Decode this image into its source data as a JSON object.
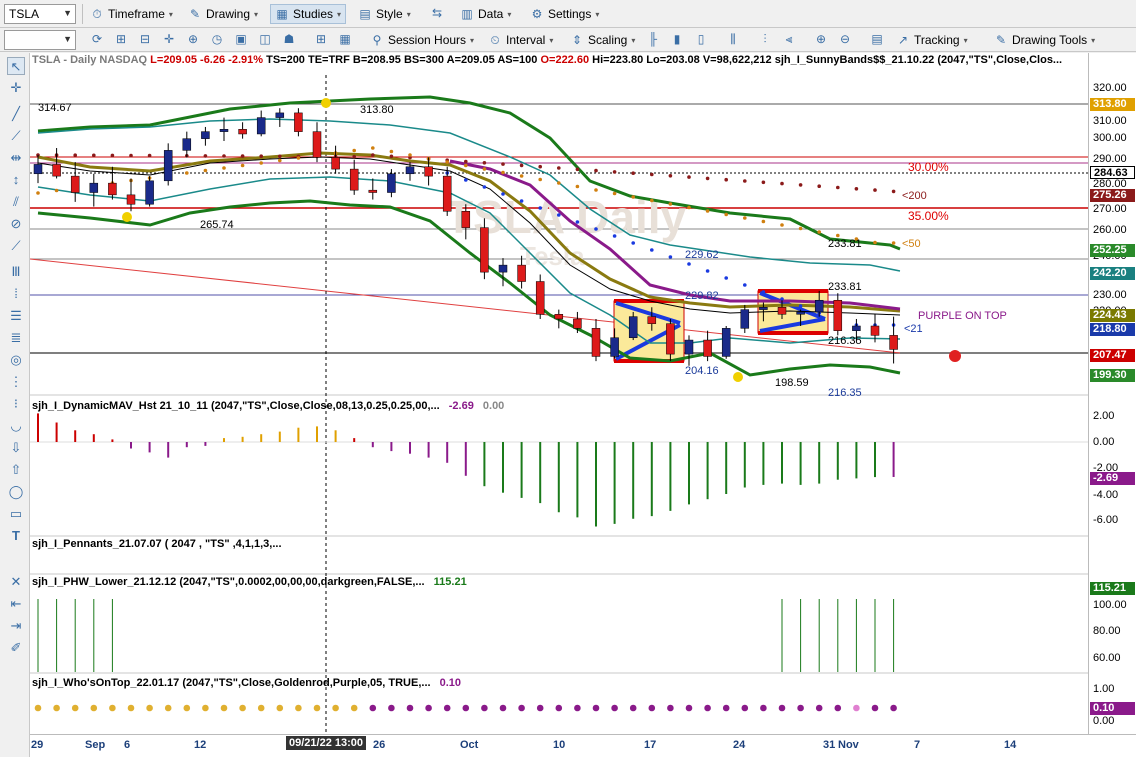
{
  "toolbar1": {
    "symbol": "TSLA",
    "timeframe": "Timeframe",
    "drawing": "Drawing",
    "studies": "Studies",
    "style": "Style",
    "data": "Data",
    "settings": "Settings"
  },
  "toolbar2": {
    "session_hours": "Session Hours",
    "interval": "Interval",
    "scaling": "Scaling",
    "tracking": "Tracking",
    "drawing_tools": "Drawing Tools"
  },
  "header": {
    "symbol_info": "TSLA - Daily  NASDAQ",
    "last": "L=209.05",
    "change": "-6.26",
    "pct": "-2.91%",
    "rest": "TS=200  TE=TRF  B=208.95  BS=300  A=209.05  AS=100",
    "open": "O=222.60",
    "hilo": "Hi=223.80  Lo=203.08  V=98,622,212  sjh_I_SunnyBands$$_21.10.22 (2047,\"TS\",Close,Clos..."
  },
  "annotations": {
    "a1": "314.67",
    "a2": "313.80",
    "a3": "265.74",
    "a4": "229.62",
    "a5": "229.82",
    "a6": "233.81",
    "a7": "233.81",
    "a8": "216.35",
    "a9": "204.16",
    "a10": "198.59",
    "a11": "216.35",
    "pct30": "30.00%",
    "pct35": "35.00%",
    "lt200": "<200",
    "lt50": "<50",
    "lt21": "<21",
    "purple": "PURPLE ON TOP",
    "watermark": "TSLA Daily",
    "watermark2": "Tesla"
  },
  "price_axis": [
    "320.00",
    "310.00",
    "300.00",
    "290.00",
    "280.00",
    "270.00",
    "260.00",
    "240.00",
    "230.00",
    "220.00"
  ],
  "price_tags": [
    {
      "label": "313.80",
      "color": "#e0a000"
    },
    {
      "label": "284.63",
      "color": "#ffffff",
      "fg": "#000"
    },
    {
      "label": "275.26",
      "color": "#8b1a1a"
    },
    {
      "label": "252.25",
      "color": "#2a8a2a"
    },
    {
      "label": "242.20",
      "color": "#1a8080"
    },
    {
      "label": "224.43",
      "color": "#7a7a00"
    },
    {
      "label": "218.80",
      "color": "#1a3aaa"
    },
    {
      "label": "207.47",
      "color": "#cc0000"
    },
    {
      "label": "199.30",
      "color": "#2a8a2a"
    }
  ],
  "panes": {
    "dynmav": {
      "title": "sjh_I_DynamicMAV_Hst 21_10_11 (2047,\"TS\",Close,Close,08,13,0.25,0.25,00,...",
      "v1": "-2.69",
      "v2": "0.00",
      "axis": [
        "2.00",
        "0.00",
        "-2.00",
        "-4.00",
        "-6.00"
      ],
      "tag": "-2.69"
    },
    "pennants": {
      "title": "sjh_I_Pennants_21.07.07 ( 2047 , \"TS\" ,4,1,1,3,..."
    },
    "phw": {
      "title": "sjh_I_PHW_Lower_21.12.12 (2047,\"TS\",0.0002,00,00,00,darkgreen,FALSE,...",
      "v1": "115.21",
      "axis": [
        "100.00",
        "80.00",
        "60.00"
      ],
      "tag": "115.21"
    },
    "whos": {
      "title": "sjh_I_Who'sOnTop_22.01.17 (2047,\"TS\",Close,Goldenrod,Purple,05, TRUE,...",
      "v1": "0.10",
      "axis": [
        "1.00",
        "0.00"
      ],
      "tag": "0.10"
    }
  },
  "dates": [
    "29",
    "Sep",
    "6",
    "12",
    "26",
    "Oct",
    "10",
    "17",
    "24",
    "31",
    "Nov",
    "7",
    "14"
  ],
  "cursor_date": "09/21/22 13:00",
  "chart_data": {
    "type": "candlestick",
    "title": "TSLA - Daily NASDAQ",
    "ohlc": [
      [
        284,
        292,
        280,
        288
      ],
      [
        288,
        295,
        282,
        283
      ],
      [
        283,
        289,
        272,
        276
      ],
      [
        276,
        284,
        270,
        280
      ],
      [
        280,
        287,
        273,
        275
      ],
      [
        275,
        282,
        268,
        271
      ],
      [
        271,
        283,
        270,
        281
      ],
      [
        281,
        297,
        279,
        294
      ],
      [
        294,
        302,
        291,
        299
      ],
      [
        299,
        304,
        296,
        302
      ],
      [
        302,
        308,
        298,
        303
      ],
      [
        303,
        306,
        299,
        301
      ],
      [
        301,
        311,
        300,
        308
      ],
      [
        308,
        312,
        304,
        310
      ],
      [
        310,
        312,
        300,
        302
      ],
      [
        302,
        306,
        289,
        291
      ],
      [
        291,
        296,
        284,
        286
      ],
      [
        286,
        290,
        275,
        277
      ],
      [
        277,
        282,
        273,
        276
      ],
      [
        276,
        286,
        274,
        284
      ],
      [
        284,
        289,
        281,
        287
      ],
      [
        287,
        291,
        279,
        283
      ],
      [
        283,
        287,
        266,
        268
      ],
      [
        268,
        271,
        256,
        261
      ],
      [
        261,
        265,
        239,
        242
      ],
      [
        242,
        248,
        236,
        245
      ],
      [
        245,
        249,
        235,
        238
      ],
      [
        238,
        241,
        222,
        224
      ],
      [
        224,
        226,
        218,
        222
      ],
      [
        222,
        225,
        216,
        218
      ],
      [
        218,
        222,
        204,
        206
      ],
      [
        206,
        218,
        205,
        214
      ],
      [
        214,
        225,
        213,
        223
      ],
      [
        223,
        227,
        217,
        220
      ],
      [
        220,
        222,
        204,
        207
      ],
      [
        207,
        215,
        202,
        213
      ],
      [
        213,
        217,
        204,
        206
      ],
      [
        206,
        219,
        205,
        218
      ],
      [
        218,
        228,
        216,
        226
      ],
      [
        226,
        229,
        221,
        227
      ],
      [
        227,
        230,
        222,
        224
      ],
      [
        224,
        226,
        219,
        225
      ],
      [
        225,
        234,
        223,
        230
      ],
      [
        230,
        233,
        215,
        217
      ],
      [
        217,
        222,
        212,
        219
      ],
      [
        219,
        224,
        212,
        215
      ],
      [
        215,
        223,
        203,
        209
      ]
    ]
  }
}
